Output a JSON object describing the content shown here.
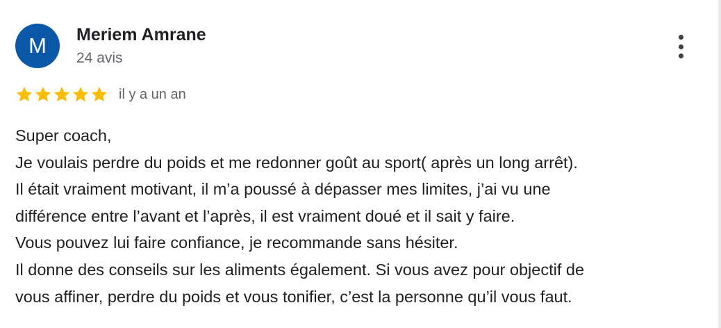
{
  "colors": {
    "avatar_bg": "#0b57a8",
    "star": "#fbbc04",
    "text": "#202124",
    "meta": "#5f6368"
  },
  "review": {
    "author": {
      "initial": "M",
      "name": "Meriem Amrane",
      "review_count": "24 avis"
    },
    "rating": 5,
    "rating_max": 5,
    "star_icon": "star-icon",
    "more_icon": "more-vert-icon",
    "date": "il y a un an",
    "text_lines": [
      "Super coach,",
      "Je voulais perdre du poids et me redonner goût au sport( après un long arrêt).",
      "Il était vraiment motivant, il m’a poussé à dépasser mes limites, j’ai vu une",
      "différence entre l’avant et l’après, il est vraiment doué et il sait y faire.",
      "Vous pouvez lui faire confiance, je recommande sans hésiter.",
      "Il donne des conseils sur les aliments également. Si vous avez pour objectif de",
      "vous affiner, perdre du poids et vous tonifier, c’est la personne qu’il vous faut."
    ]
  }
}
